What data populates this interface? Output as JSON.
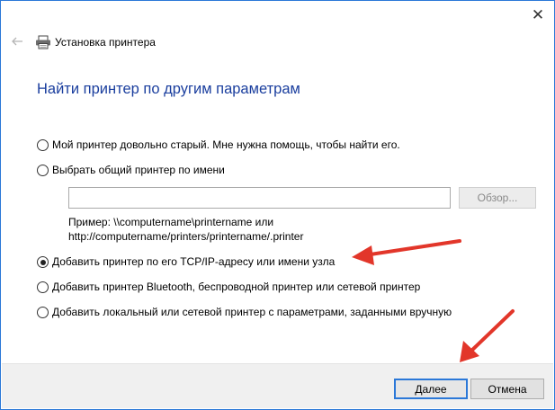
{
  "window": {
    "title": "Установка принтера",
    "close_glyph": "✕"
  },
  "page": {
    "heading": "Найти принтер по другим параметрам"
  },
  "options": [
    {
      "label": "Мой принтер довольно старый. Мне нужна помощь, чтобы найти его.",
      "checked": false
    },
    {
      "label": "Выбрать общий принтер по имени",
      "checked": false
    },
    {
      "label": "Добавить принтер по его TCP/IP-адресу или имени узла",
      "checked": true
    },
    {
      "label": "Добавить принтер Bluetooth, беспроводной принтер или сетевой принтер",
      "checked": false
    },
    {
      "label": "Добавить локальный или сетевой принтер с параметрами, заданными вручную",
      "checked": false
    }
  ],
  "share": {
    "value": "",
    "browse_label": "Обзор...",
    "example_line1": "Пример: \\\\computername\\printername или",
    "example_line2": "http://computername/printers/printername/.printer"
  },
  "footer": {
    "next_label": "Далее",
    "cancel_label": "Отмена"
  },
  "colors": {
    "accent": "#2b78d8",
    "heading": "#1a3e9e",
    "annotation_arrow": "#e2362a"
  },
  "icons": {
    "back": "back-arrow-icon",
    "printer": "printer-icon",
    "close": "close-icon"
  }
}
